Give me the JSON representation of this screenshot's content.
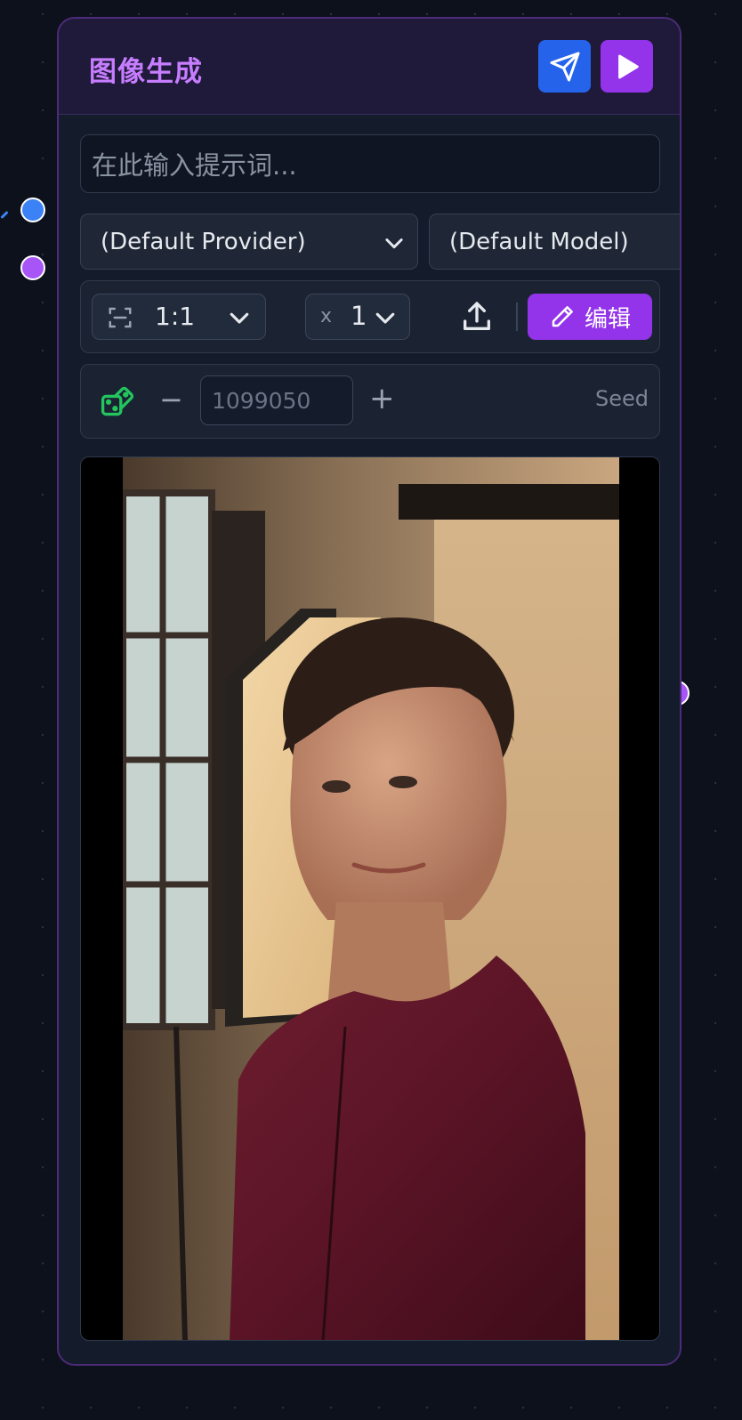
{
  "node": {
    "title": "图像生成",
    "send_icon": "send-icon",
    "run_icon": "play-icon"
  },
  "prompt": {
    "placeholder": "在此输入提示词..."
  },
  "provider": {
    "value": "(Default Provider)"
  },
  "model": {
    "value": "(Default Model)"
  },
  "toolbar": {
    "ratio": "1:1",
    "count_prefix": "x",
    "count": "1",
    "edit_label": "编辑"
  },
  "seed": {
    "value": "1099050",
    "label": "Seed"
  },
  "colors": {
    "accent_purple": "#9333ea",
    "accent_blue": "#2563eb",
    "title": "#c77dff",
    "dice": "#22c55e"
  }
}
